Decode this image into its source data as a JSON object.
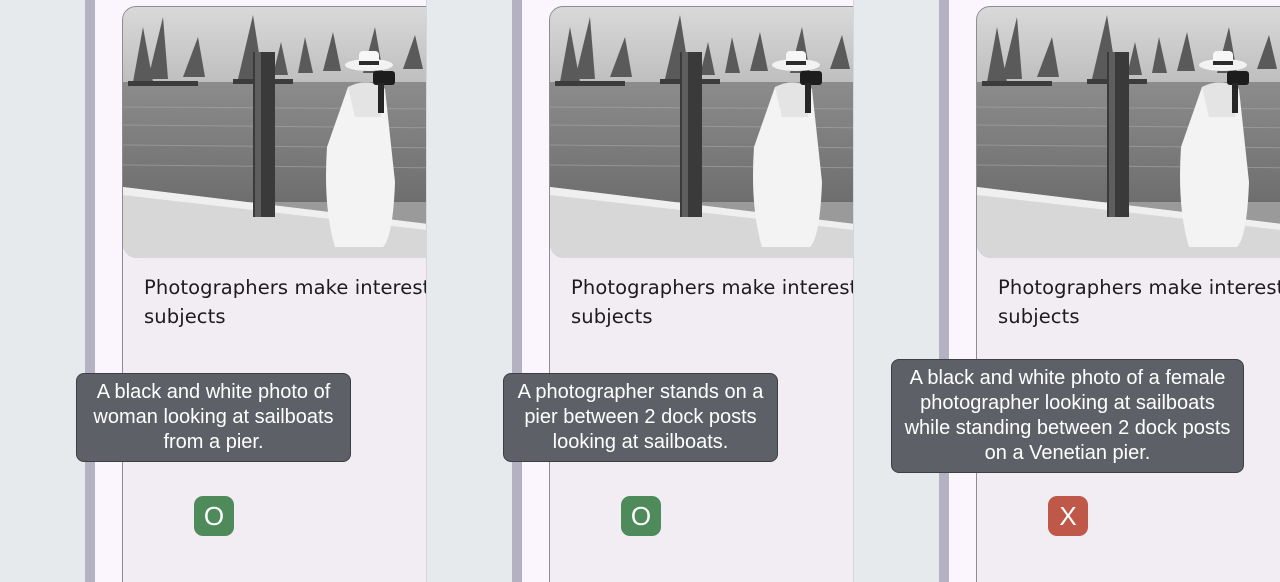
{
  "card_title_line1": "Photographers make interesting",
  "card_title_line2": "subjects",
  "panels": [
    {
      "caption": "A black and white photo of woman looking at sailboats from a pier.",
      "verdict": "O",
      "verdict_color": "#4f8a5b"
    },
    {
      "caption": "A photographer stands on a pier between 2 dock posts looking at sailboats.",
      "verdict": "O",
      "verdict_color": "#4f8a5b"
    },
    {
      "caption": "A black and white photo of a female photographer looking at sailboats while standing between 2 dock posts on a Venetian pier.",
      "verdict": "X",
      "verdict_color": "#c0584a"
    }
  ],
  "colors": {
    "background": "#e6eaec",
    "phone_edge": "#b4b1c2",
    "card": "#f1edf3",
    "tooltip": "#5d6167"
  }
}
